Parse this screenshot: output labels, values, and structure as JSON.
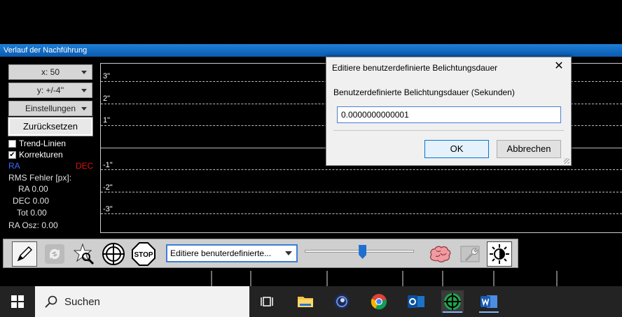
{
  "window": {
    "title": "Verlauf der Nachführung"
  },
  "controls": {
    "x_scale": "x:  50",
    "y_scale": "y: +/-4''",
    "settings": "Einstellungen",
    "reset": "Zurücksetzen",
    "trend_lines": {
      "label": "Trend-Linien",
      "checked": false
    },
    "corrections": {
      "label": "Korrekturen",
      "checked": true,
      "mark": "✔"
    },
    "ra_label": "RA",
    "dec_label": "DEC",
    "ra_color": "#3a6bff",
    "dec_color": "#e01010"
  },
  "stats": {
    "rms_title": "RMS Fehler [px]:",
    "ra": "RA 0.00",
    "dec": "DEC 0.00",
    "tot": "Tot 0.00",
    "ra_osc": "RA Osz: 0.00"
  },
  "plot": {
    "y_labels": [
      "3\"",
      "2\"",
      "1\"",
      "-1\"",
      "-2\"",
      "-3\""
    ]
  },
  "toolbar": {
    "combo_value": "Editiere benuterdefinierte...",
    "exposure_slider_fraction": 0.53,
    "stop_label": "STOP"
  },
  "dialog": {
    "title": "Editiere benutzerdefinierte Belichtungsdauer",
    "close": "✕",
    "label": "Benutzerdefinierte Belichtungsdauer (Sekunden)",
    "value": "0.0000000000001",
    "ok": "OK",
    "cancel": "Abbrechen"
  },
  "taskbar": {
    "search_placeholder": "Suchen",
    "apps": [
      "task-view",
      "file-explorer",
      "cinema-4d",
      "chrome",
      "outlook",
      "phd2-guiding",
      "word"
    ]
  }
}
